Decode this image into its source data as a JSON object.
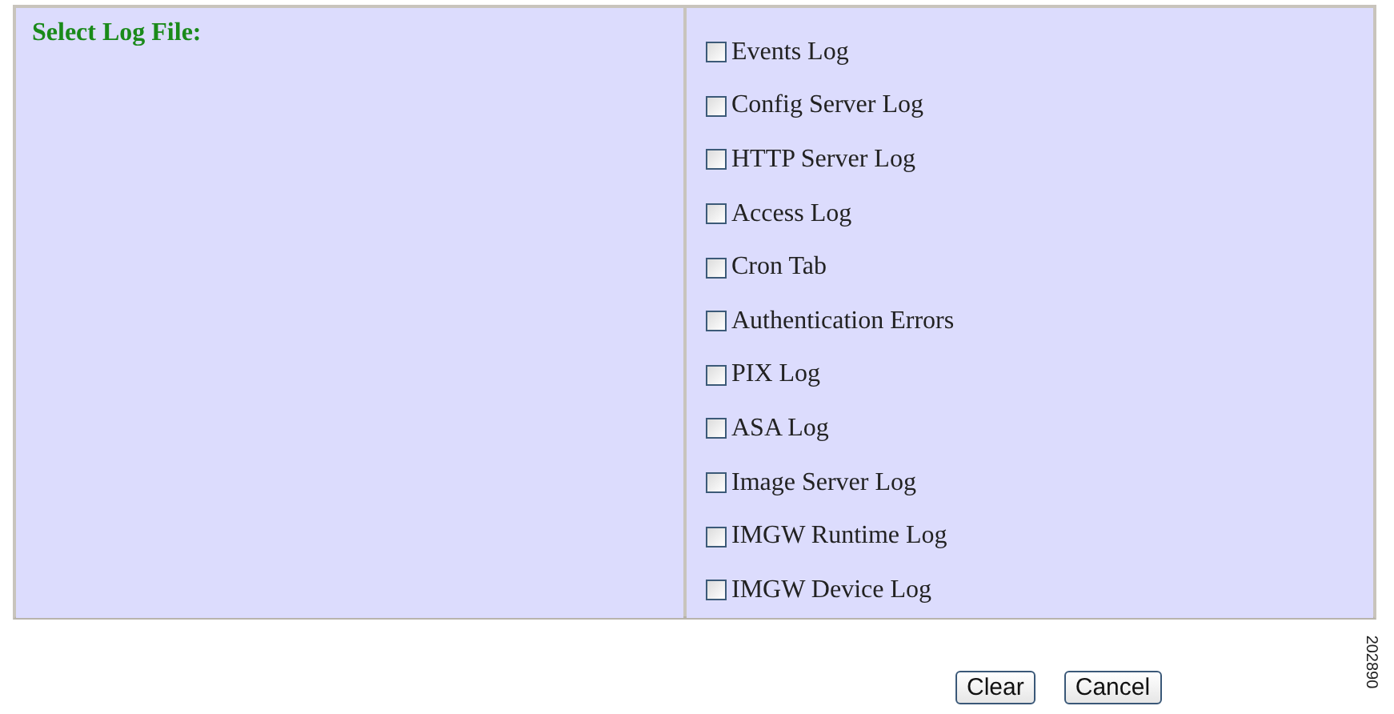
{
  "form": {
    "label": "Select Log File:",
    "log_files": [
      {
        "label": "Events Log",
        "checked": false
      },
      {
        "label": "Config Server Log",
        "checked": false
      },
      {
        "label": "HTTP Server Log",
        "checked": false
      },
      {
        "label": "Access Log",
        "checked": false
      },
      {
        "label": "Cron Tab",
        "checked": false
      },
      {
        "label": "Authentication Errors",
        "checked": false
      },
      {
        "label": "PIX Log",
        "checked": false
      },
      {
        "label": "ASA Log",
        "checked": false
      },
      {
        "label": "Image Server Log",
        "checked": false
      },
      {
        "label": "IMGW Runtime Log",
        "checked": false
      },
      {
        "label": "IMGW Device Log",
        "checked": false
      }
    ]
  },
  "buttons": [
    "Clear",
    "Cancel"
  ],
  "figure_number": "202890"
}
